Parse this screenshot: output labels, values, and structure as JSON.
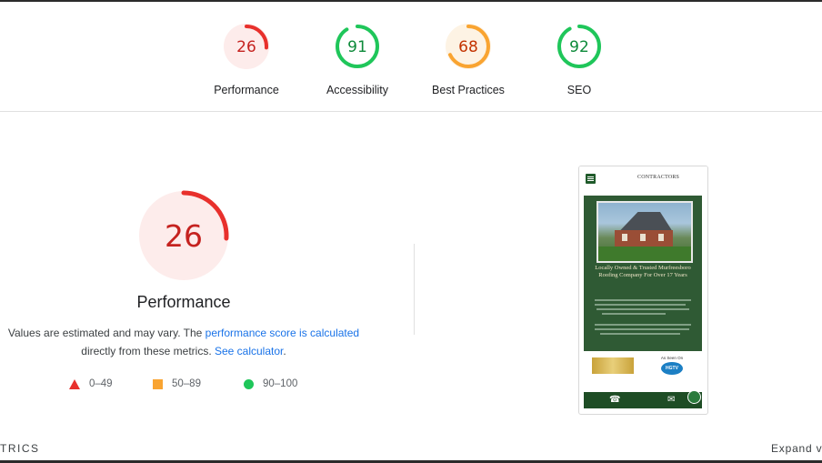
{
  "summary": {
    "gauges": [
      {
        "score": "26",
        "label": "Performance",
        "fraction": 0.26,
        "color": "#e8302c",
        "bg": "#fdeceb",
        "text_color": "#c5221f"
      },
      {
        "score": "91",
        "label": "Accessibility",
        "fraction": 0.91,
        "color": "#1fc65a",
        "bg": "#ffffff",
        "text_color": "#0d8a3a"
      },
      {
        "score": "68",
        "label": "Best Practices",
        "fraction": 0.68,
        "color": "#f9a431",
        "bg": "#fdf3e4",
        "text_color": "#c33300"
      },
      {
        "score": "92",
        "label": "SEO",
        "fraction": 0.92,
        "color": "#1fc65a",
        "bg": "#ffffff",
        "text_color": "#0d8a3a"
      }
    ]
  },
  "performance": {
    "score": "26",
    "fraction": 0.26,
    "title": "Performance",
    "desc_prefix": "Values are estimated and may vary. The ",
    "desc_link1": "performance score is calculated",
    "desc_middle": "directly from these metrics. ",
    "desc_link2": "See calculator",
    "desc_suffix": ".",
    "color": "#e8302c",
    "bg": "#fdeceb",
    "text_color": "#c5221f"
  },
  "legend": [
    {
      "icon": "triangle-icon",
      "range": "0–49"
    },
    {
      "icon": "square-icon",
      "range": "50–89"
    },
    {
      "icon": "circle-icon",
      "range": "90–100"
    }
  ],
  "screenshot": {
    "logo": "CONTRACTORS",
    "headline": "Locally Owned & Trusted Murfreesboro Roofing Company For Over 17 Years",
    "badge_right_title": "As Seen On",
    "badge_right": "HGTV"
  },
  "footer": {
    "left": "TRICS",
    "right": "Expand v"
  }
}
